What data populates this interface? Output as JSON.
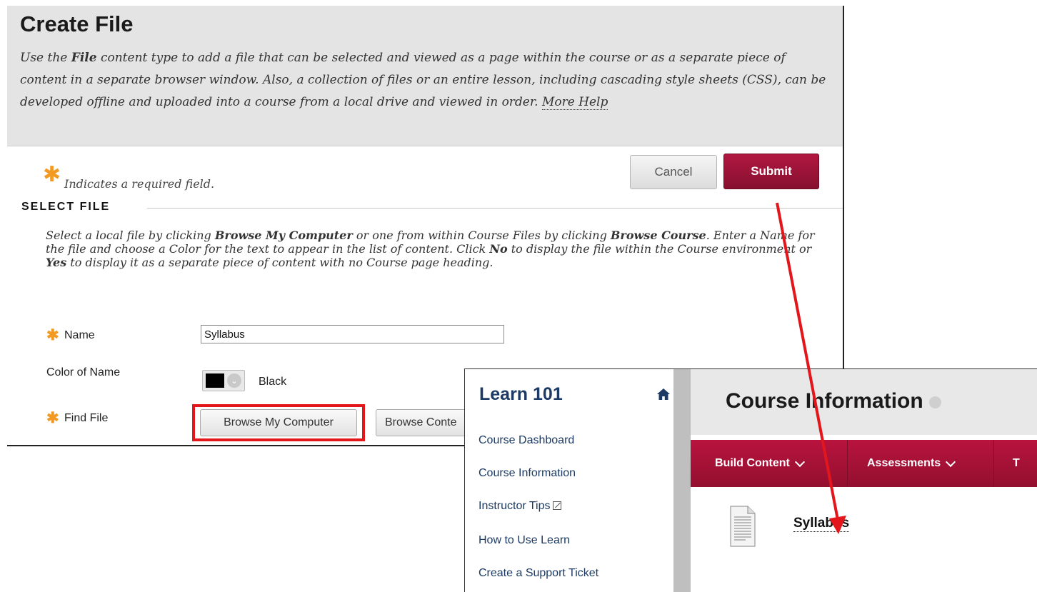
{
  "create_file": {
    "title": "Create File",
    "desc_1": "Use the ",
    "desc_bold": "File",
    "desc_2": " content type to add a file that can be selected and viewed as a page within the course or as a separate piece of content in a separate browser window. Also, a collection of files or an entire lesson, including cascading style sheets (CSS), can be developed offline and uploaded into a course from a local drive and viewed in order. ",
    "more_help": "More Help",
    "required_note": "Indicates a required field.",
    "cancel_label": "Cancel",
    "submit_label": "Submit",
    "section_title": "SELECT FILE",
    "select_desc": {
      "p1": "Select a local file by clicking ",
      "b1": "Browse My Computer",
      "p2": " or one from within Course Files by clicking ",
      "b2": "Browse Course",
      "p3": ". Enter a Name for the file and choose a Color for the text to appear in the list of content. Click ",
      "b3": "No",
      "p4": " to display the file within the Course environment or ",
      "b4": "Yes",
      "p5": " to display it as a separate piece of content with no Course page heading."
    },
    "name_label": "Name",
    "name_value": "Syllabus",
    "color_label": "Color of Name",
    "color_value": "Black",
    "find_file_label": "Find File",
    "browse_computer_label": "Browse My Computer",
    "browse_content_label": "Browse Conte"
  },
  "course": {
    "title": "Learn 101",
    "nav": [
      "Course Dashboard",
      "Course Information",
      "Instructor Tips",
      "How to Use Learn",
      "Create a Support Ticket"
    ],
    "main_title": "Course Information",
    "actions": [
      "Build Content",
      "Assessments",
      "T"
    ],
    "item_title": "Syllabus"
  },
  "colors": {
    "accent": "#a0143a",
    "required_star": "#f39a24",
    "nav_text": "#1c3a63",
    "highlight": "#e3161b"
  },
  "icons": [
    "home-icon",
    "external-link-icon",
    "chevron-down-icon",
    "document-icon",
    "asterisk-icon"
  ]
}
